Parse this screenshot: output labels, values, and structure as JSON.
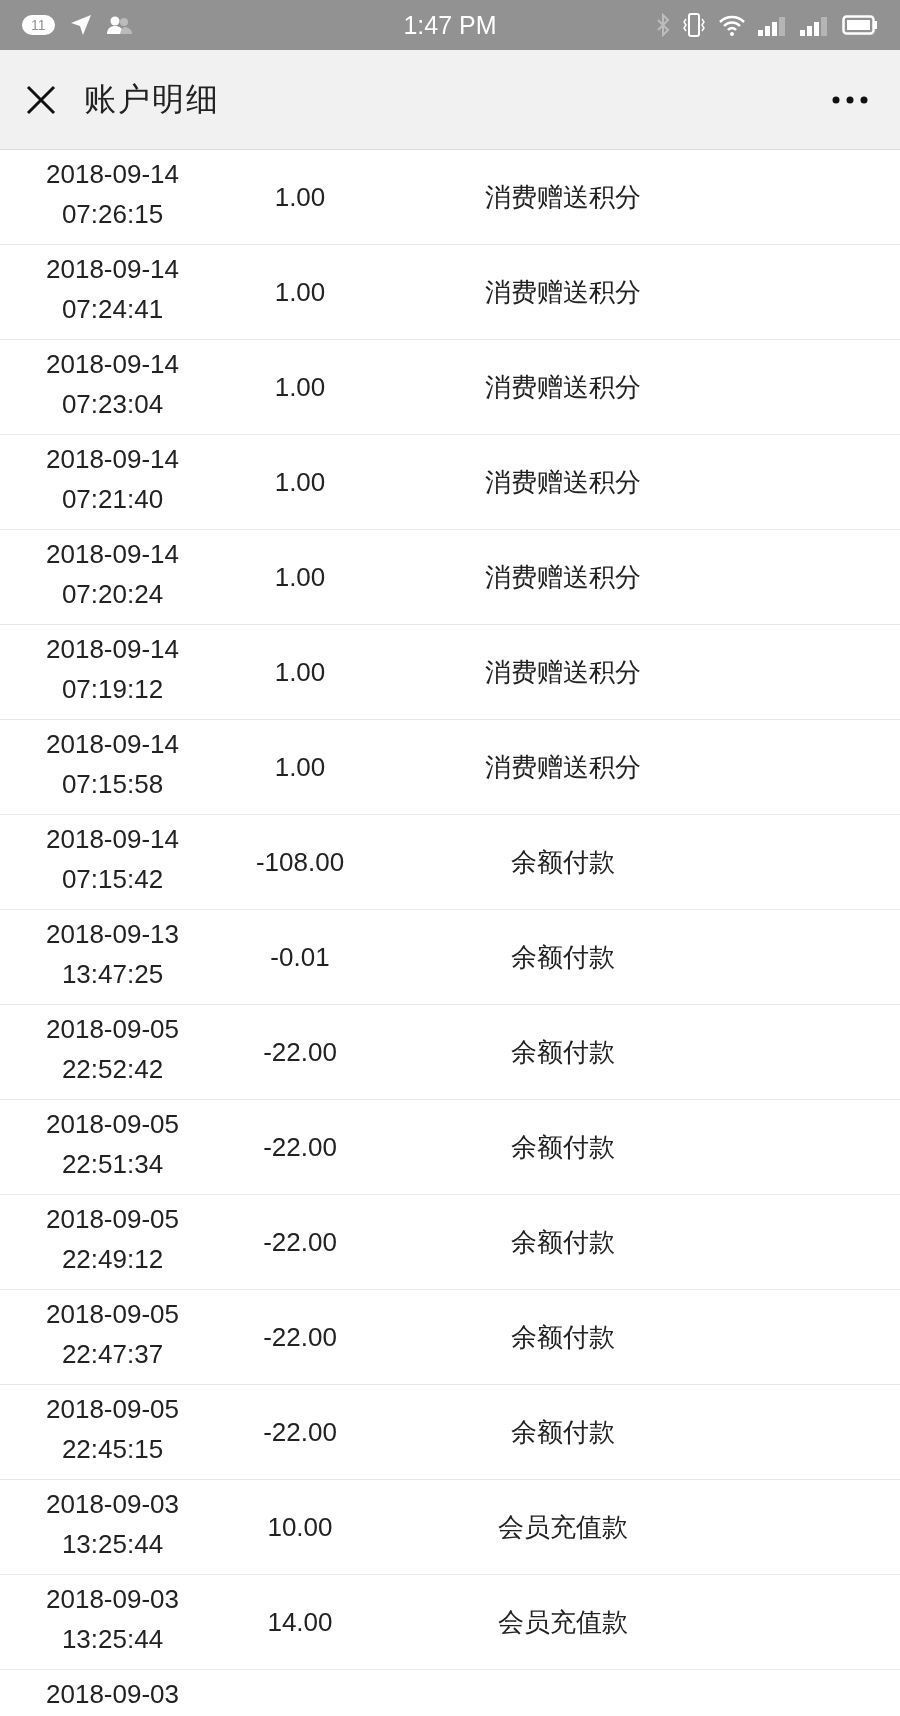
{
  "status_bar": {
    "notification_count": "11",
    "time": "1:47 PM"
  },
  "header": {
    "title": "账户明细"
  },
  "rows": [
    {
      "date": "2018-09-14",
      "time": "07:26:15",
      "amount": "1.00",
      "description": "消费赠送积分"
    },
    {
      "date": "2018-09-14",
      "time": "07:24:41",
      "amount": "1.00",
      "description": "消费赠送积分"
    },
    {
      "date": "2018-09-14",
      "time": "07:23:04",
      "amount": "1.00",
      "description": "消费赠送积分"
    },
    {
      "date": "2018-09-14",
      "time": "07:21:40",
      "amount": "1.00",
      "description": "消费赠送积分"
    },
    {
      "date": "2018-09-14",
      "time": "07:20:24",
      "amount": "1.00",
      "description": "消费赠送积分"
    },
    {
      "date": "2018-09-14",
      "time": "07:19:12",
      "amount": "1.00",
      "description": "消费赠送积分"
    },
    {
      "date": "2018-09-14",
      "time": "07:15:58",
      "amount": "1.00",
      "description": "消费赠送积分"
    },
    {
      "date": "2018-09-14",
      "time": "07:15:42",
      "amount": "-108.00",
      "description": "余额付款"
    },
    {
      "date": "2018-09-13",
      "time": "13:47:25",
      "amount": "-0.01",
      "description": "余额付款"
    },
    {
      "date": "2018-09-05",
      "time": "22:52:42",
      "amount": "-22.00",
      "description": "余额付款"
    },
    {
      "date": "2018-09-05",
      "time": "22:51:34",
      "amount": "-22.00",
      "description": "余额付款"
    },
    {
      "date": "2018-09-05",
      "time": "22:49:12",
      "amount": "-22.00",
      "description": "余额付款"
    },
    {
      "date": "2018-09-05",
      "time": "22:47:37",
      "amount": "-22.00",
      "description": "余额付款"
    },
    {
      "date": "2018-09-05",
      "time": "22:45:15",
      "amount": "-22.00",
      "description": "余额付款"
    },
    {
      "date": "2018-09-03",
      "time": "13:25:44",
      "amount": "10.00",
      "description": "会员充值款"
    },
    {
      "date": "2018-09-03",
      "time": "13:25:44",
      "amount": "14.00",
      "description": "会员充值款"
    },
    {
      "date": "2018-09-03"
    }
  ]
}
